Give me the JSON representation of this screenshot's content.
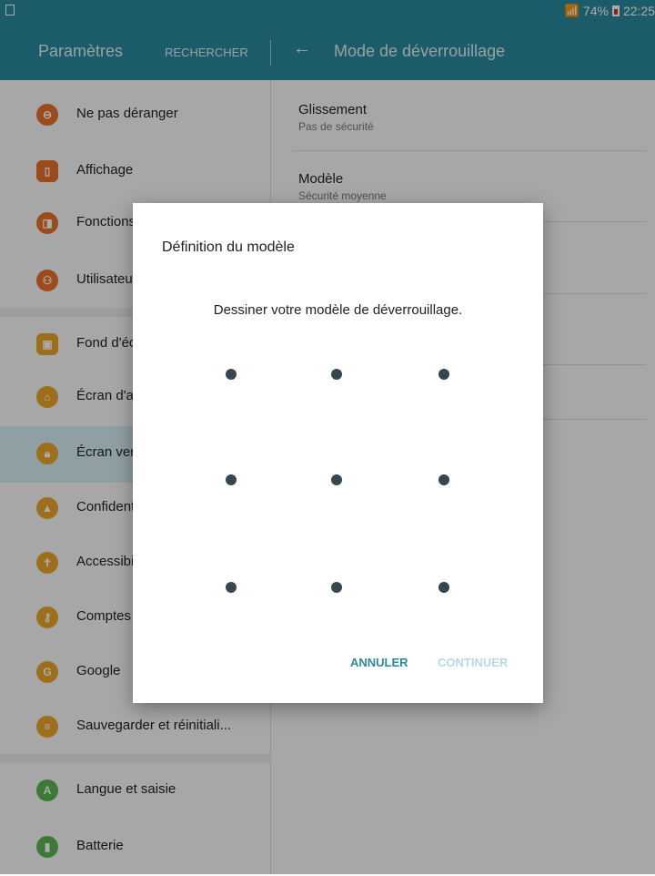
{
  "status_bar": {
    "battery": "74%",
    "time": "22:25",
    "wifi_icon": "wifi-icon",
    "notification_icon": "screenshot-icon"
  },
  "app_bar": {
    "left_title": "Paramètres",
    "search_label": "RECHERCHER",
    "back_icon": "←",
    "right_title": "Mode de déverrouillage"
  },
  "sidebar": {
    "items": [
      {
        "label": "Ne pas déranger",
        "icon": "minus-circle-icon",
        "color": "#e8702a"
      },
      {
        "label": "Affichage",
        "icon": "display-icon",
        "color": "#e8702a"
      },
      {
        "label": "Fonctions avancées",
        "icon": "gesture-icon",
        "color": "#e8702a"
      },
      {
        "label": "Utilisateurs",
        "icon": "users-icon",
        "color": "#e8702a"
      },
      {
        "label": "Fond d'écran",
        "icon": "image-icon",
        "color": "#eba629"
      },
      {
        "label": "Écran d'accueil",
        "icon": "home-icon",
        "color": "#eba629"
      },
      {
        "label": "Écran verrouillage",
        "icon": "lock-icon",
        "color": "#eba629"
      },
      {
        "label": "Confidentialité",
        "icon": "shield-icon",
        "color": "#eba629"
      },
      {
        "label": "Accessibilité",
        "icon": "accessibility-icon",
        "color": "#eba629"
      },
      {
        "label": "Comptes",
        "icon": "key-icon",
        "color": "#eba629"
      },
      {
        "label": "Google",
        "icon": "google-icon",
        "color": "#eba629"
      },
      {
        "label": "Sauvegarder et réinitiali...",
        "icon": "backup-icon",
        "color": "#eba629"
      },
      {
        "label": "Langue et saisie",
        "icon": "keyboard-icon",
        "color": "#58b54f"
      },
      {
        "label": "Batterie",
        "icon": "battery-icon",
        "color": "#58b54f"
      }
    ]
  },
  "unlock_options": [
    {
      "title": "Glissement",
      "subtitle": "Pas de sécurité"
    },
    {
      "title": "Modèle",
      "subtitle": "Sécurité moyenne"
    }
  ],
  "dialog": {
    "title": "Définition du modèle",
    "message": "Dessiner votre modèle de déverrouillage.",
    "cancel_label": "ANNULER",
    "continue_label": "CONTINUER"
  },
  "colors": {
    "accent": "#2b8a9e",
    "orange": "#e8702a",
    "amber": "#eba629",
    "green": "#58b54f"
  }
}
